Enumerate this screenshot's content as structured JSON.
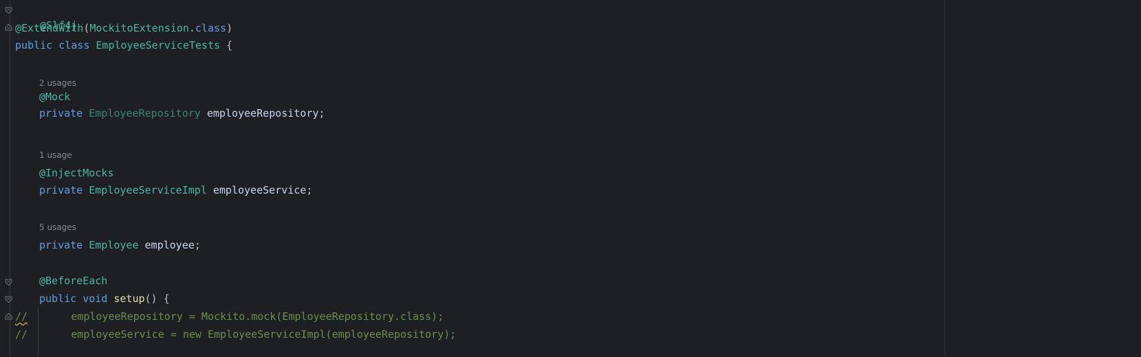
{
  "code": {
    "l1_annotation": "@Slf4j",
    "l2_annotation": "@ExtendWith",
    "l2_open": "(",
    "l2_class": "MockitoExtension",
    "l2_dot": ".",
    "l2_kw": "class",
    "l2_close": ")",
    "l3_public": "public",
    "l3_class": "class",
    "l3_name": "EmployeeServiceTests",
    "l3_brace": " {",
    "hint1": "2 usages",
    "l4_annotation": "@Mock",
    "l5_private": "private",
    "l5_type": "EmployeeRepository",
    "l5_field": "employeeRepository",
    "l5_semi": ";",
    "hint2": "1 usage",
    "l6_annotation": "@InjectMocks",
    "l7_private": "private",
    "l7_type": "EmployeeServiceImpl",
    "l7_field": "employeeService",
    "l7_semi": ";",
    "hint3": "5 usages",
    "l8_private": "private",
    "l8_type": "Employee",
    "l8_field": "employee",
    "l8_semi": ";",
    "l9_annotation": "@BeforeEach",
    "l10_public": "public",
    "l10_void": "void",
    "l10_method": "setup",
    "l10_rest": "() {",
    "l11_slashes": "//",
    "l11_comment": "       employeeRepository = Mockito.mock(EmployeeRepository.class);",
    "l12_comment": "//       employeeService = new EmployeeServiceImpl(employeeRepository);"
  },
  "colors": {
    "background": "#1e1f22",
    "annotation": "#49b7a6",
    "keyword": "#5f9fe0",
    "comment": "#6d8e4a"
  }
}
